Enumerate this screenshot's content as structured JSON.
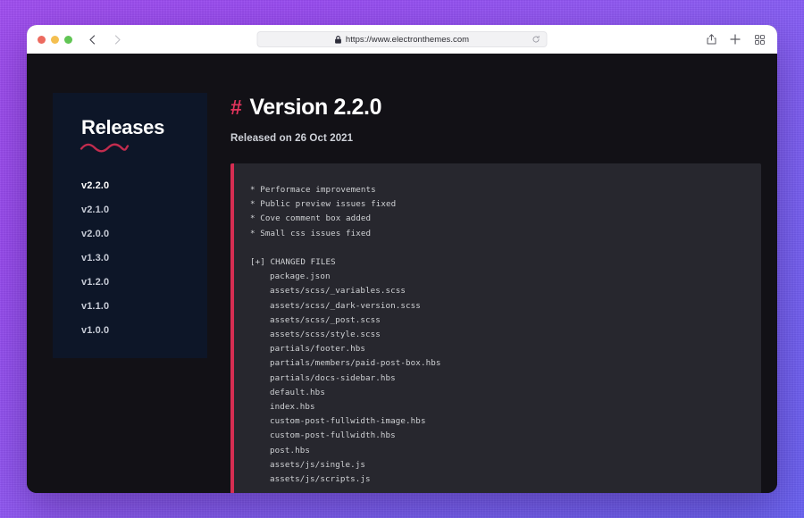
{
  "browser": {
    "traffic_lights": [
      "close",
      "minimize",
      "maximize"
    ],
    "back_label": "Back",
    "forward_label": "Forward",
    "url": "https://www.electronthemes.com",
    "lock_icon": "lock-icon",
    "reload_icon": "reload-icon",
    "share_icon": "share-icon",
    "new_tab_icon": "plus-icon",
    "tab_overview_icon": "grid-icon"
  },
  "sidebar": {
    "title": "Releases",
    "versions": [
      {
        "label": "v2.2.0",
        "active": true
      },
      {
        "label": "v2.1.0",
        "active": false
      },
      {
        "label": "v2.0.0",
        "active": false
      },
      {
        "label": "v1.3.0",
        "active": false
      },
      {
        "label": "v1.2.0",
        "active": false
      },
      {
        "label": "v1.1.0",
        "active": false
      },
      {
        "label": "v1.0.0",
        "active": false
      }
    ]
  },
  "main": {
    "hash": "#",
    "title": "Version 2.2.0",
    "released": "Released on 26 Oct 2021",
    "changelog": [
      {
        "text": "* Performace improvements",
        "indent": false
      },
      {
        "text": "* Public preview issues fixed",
        "indent": false
      },
      {
        "text": "* Cove comment box added",
        "indent": false
      },
      {
        "text": "* Small css issues fixed",
        "indent": false
      },
      {
        "text": "",
        "indent": false
      },
      {
        "text": "[+] CHANGED FILES",
        "indent": false
      },
      {
        "text": "package.json",
        "indent": true
      },
      {
        "text": "assets/scss/_variables.scss",
        "indent": true
      },
      {
        "text": "assets/scss/_dark-version.scss",
        "indent": true
      },
      {
        "text": "assets/scss/_post.scss",
        "indent": true
      },
      {
        "text": "assets/scss/style.scss",
        "indent": true
      },
      {
        "text": "partials/footer.hbs",
        "indent": true
      },
      {
        "text": "partials/members/paid-post-box.hbs",
        "indent": true
      },
      {
        "text": "partials/docs-sidebar.hbs",
        "indent": true
      },
      {
        "text": "default.hbs",
        "indent": true
      },
      {
        "text": "index.hbs",
        "indent": true
      },
      {
        "text": "custom-post-fullwidth-image.hbs",
        "indent": true
      },
      {
        "text": "custom-post-fullwidth.hbs",
        "indent": true
      },
      {
        "text": "post.hbs",
        "indent": true
      },
      {
        "text": "assets/js/single.js",
        "indent": true
      },
      {
        "text": "assets/js/scripts.js",
        "indent": true
      }
    ]
  },
  "colors": {
    "accent": "#d62e52",
    "hash": "#e0345c",
    "page_bg": "#121116",
    "sidebar_bg": "#0d1628",
    "code_bg": "#27272e"
  }
}
